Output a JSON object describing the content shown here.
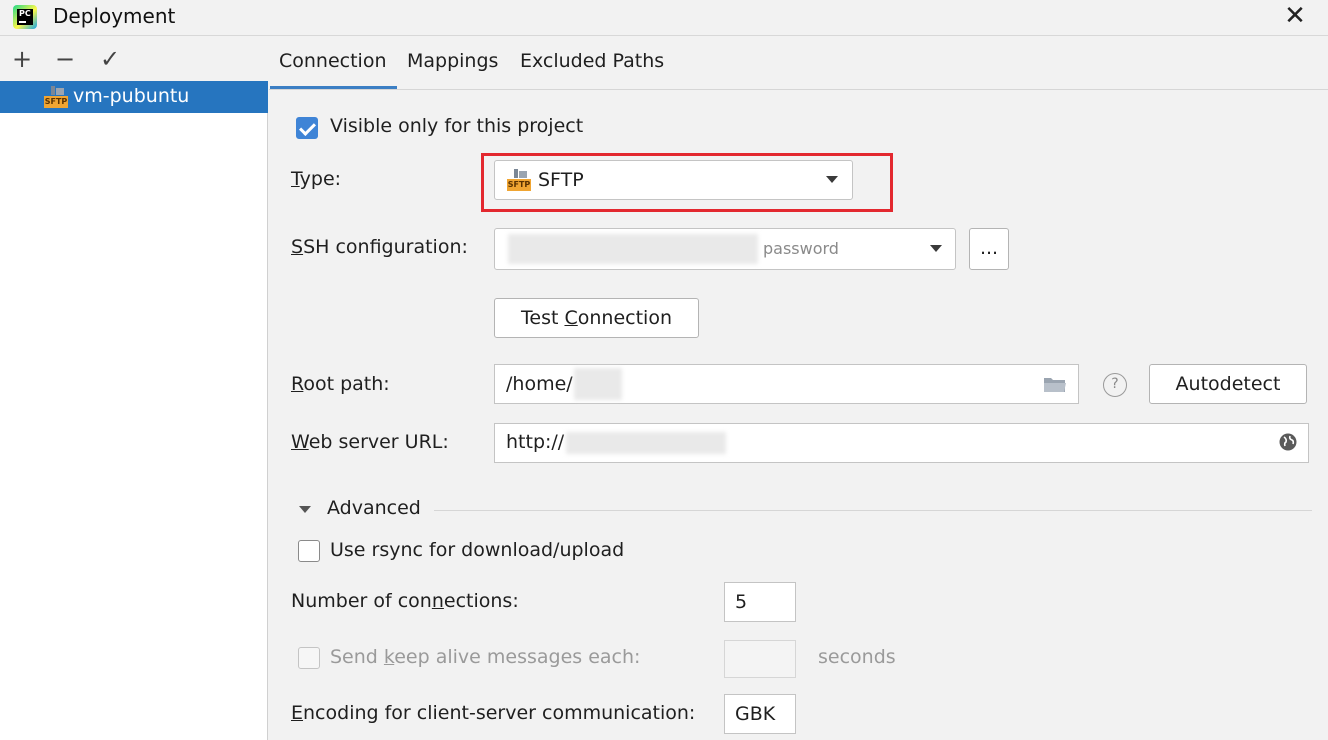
{
  "window": {
    "title": "Deployment",
    "close": "✕"
  },
  "toolbar": {
    "add": "+",
    "remove": "−",
    "apply": "✓"
  },
  "servers": [
    {
      "name": "vm-pubuntu",
      "icon": "sftp-icon",
      "icon_text": "SFTP"
    }
  ],
  "tabs": [
    {
      "label": "Connection",
      "selected": true
    },
    {
      "label": "Mappings",
      "selected": false
    },
    {
      "label": "Excluded Paths",
      "selected": false
    }
  ],
  "form": {
    "visible_only": {
      "label": "Visible only for this project",
      "checked": true
    },
    "type": {
      "label": "Type:",
      "value": "SFTP",
      "icon_text": "SFTP"
    },
    "ssh": {
      "label": "SSH configuration:",
      "suffix": "password",
      "browse": "..."
    },
    "test_connection": "Test Connection",
    "root_path": {
      "label": "Root path:",
      "value": "/home/",
      "help": "?",
      "autodetect": "Autodetect"
    },
    "web_url": {
      "label": "Web server URL:",
      "value": "http://"
    },
    "advanced": {
      "title": "Advanced",
      "rsync": {
        "label": "Use rsync for download/upload",
        "checked": false
      },
      "connections": {
        "label": "Number of connections:",
        "value": "5"
      },
      "keep_alive": {
        "label": "Send keep alive messages each:",
        "value": "",
        "unit": "seconds",
        "enabled": false
      },
      "encoding": {
        "label": "Encoding for client-server communication:",
        "value": "GBK"
      }
    }
  },
  "colors": {
    "accent": "#3c7fc4",
    "selection": "#2675bf",
    "highlight": "#e3282f"
  }
}
